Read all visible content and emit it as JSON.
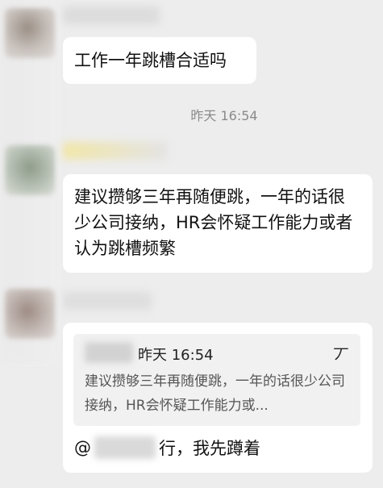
{
  "messages": [
    {
      "id": "m1",
      "text": "工作一年跳槽合适吗"
    },
    {
      "id": "m2",
      "text": "建议攒够三年再随便跳，一年的话很少公司接纳，HR会怀疑工作能力或者认为跳槽频繁"
    },
    {
      "id": "m3",
      "quote": {
        "time": "昨天 16:54",
        "text": "建议攒够三年再随便跳，一年的话很少公司接纳，HR会怀疑工作能力或...",
        "icon_glyph": "丆"
      },
      "reply_prefix": "@",
      "reply_text": "行，我先蹲着"
    }
  ],
  "timestamp": "昨天 16:54",
  "icons": {
    "quote_icon": "quote-collapse-icon"
  },
  "colors": {
    "background": "#ededed",
    "bubble": "#ffffff",
    "quote_bg": "#f1f1f1",
    "timestamp": "#8a8a8a"
  }
}
